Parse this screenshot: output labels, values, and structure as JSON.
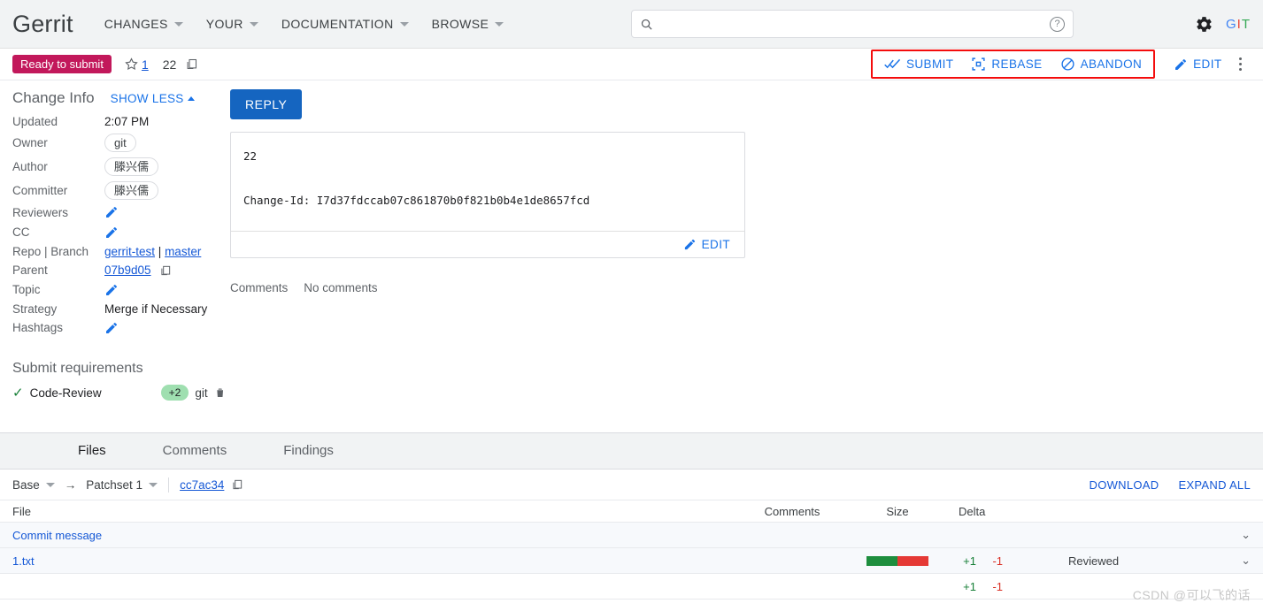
{
  "header": {
    "brand": "Gerrit",
    "nav": [
      {
        "label": "CHANGES",
        "icon": "chevron-down-icon"
      },
      {
        "label": "YOUR",
        "icon": "chevron-down-icon"
      },
      {
        "label": "DOCUMENTATION",
        "icon": "chevron-down-icon"
      },
      {
        "label": "BROWSE",
        "icon": "chevron-down-icon"
      }
    ],
    "search": {
      "value": "",
      "placeholder": "",
      "icon": "search-icon"
    },
    "help_icon": "help-circle-icon",
    "settings_icon": "gear-icon",
    "account": {
      "label": "GIT",
      "letters": [
        "G",
        "I",
        "T"
      ]
    }
  },
  "action_bar": {
    "status": "Ready to submit",
    "star_icon": "star-outline-icon",
    "star_count": "1",
    "change_number": "22",
    "copy_icon": "copy-icon",
    "highlighted_actions": [
      {
        "label": "SUBMIT",
        "icon": "double-check-icon"
      },
      {
        "label": "REBASE",
        "icon": "rebase-icon"
      },
      {
        "label": "ABANDON",
        "icon": "block-icon"
      }
    ],
    "edit": {
      "label": "EDIT",
      "icon": "pencil-icon"
    },
    "more_icon": "kebab-menu-icon",
    "highlight_color": "#f40c0c"
  },
  "change_info": {
    "title": "Change Info",
    "toggle_label": "SHOW LESS",
    "rows": [
      {
        "label": "Updated",
        "value": "2:07 PM",
        "type": "text"
      },
      {
        "label": "Owner",
        "value": "git",
        "type": "chip"
      },
      {
        "label": "Author",
        "value": "滕兴儒",
        "type": "chip"
      },
      {
        "label": "Committer",
        "value": "滕兴儒",
        "type": "chip"
      },
      {
        "label": "Reviewers",
        "value": "",
        "type": "edit"
      },
      {
        "label": "CC",
        "value": "",
        "type": "edit"
      },
      {
        "label": "Repo | Branch",
        "value": "",
        "type": "repo",
        "repo": "gerrit-test",
        "separator": "|",
        "branch": "master"
      },
      {
        "label": "Parent",
        "value": "07b9d05",
        "type": "link-copy"
      },
      {
        "label": "Topic",
        "value": "",
        "type": "edit"
      },
      {
        "label": "Strategy",
        "value": "Merge if Necessary",
        "type": "text"
      },
      {
        "label": "Hashtags",
        "value": "",
        "type": "edit"
      }
    ]
  },
  "submit_requirements": {
    "title": "Submit requirements",
    "rows": [
      {
        "check_icon": "check-icon",
        "name": "Code-Review",
        "vote": "+2",
        "voter": "git",
        "delete_icon": "trash-icon",
        "vote_color": "#9fdfb0"
      }
    ]
  },
  "commit": {
    "reply_label": "REPLY",
    "subject": "22",
    "change_id_line": "Change-Id: I7d37fdccab07c861870b0f821b0b4e1de8657fcd",
    "edit_label": "EDIT",
    "edit_icon": "pencil-icon",
    "comments_label": "Comments",
    "comments_value": "No comments"
  },
  "tabs": [
    {
      "label": "Files",
      "active": true
    },
    {
      "label": "Comments",
      "active": false
    },
    {
      "label": "Findings",
      "active": false
    }
  ],
  "patchset_row": {
    "base_label": "Base",
    "arrow": "→",
    "patchset_label": "Patchset 1",
    "revision": "cc7ac34",
    "copy_icon": "copy-icon",
    "download_label": "DOWNLOAD",
    "expand_all_label": "EXPAND ALL"
  },
  "file_table": {
    "columns": {
      "file": "File",
      "comments": "Comments",
      "size": "Size",
      "delta": "Delta"
    },
    "rows": [
      {
        "file": "Commit message",
        "comments": "",
        "size_bar": false,
        "added": "",
        "removed": "",
        "status": "",
        "chevron": "⌄"
      },
      {
        "file": "1.txt",
        "comments": "",
        "size_bar": true,
        "added": "+1",
        "removed": "-1",
        "status": "Reviewed",
        "chevron": "⌄"
      }
    ],
    "totals": {
      "added": "+1",
      "removed": "-1"
    },
    "added_color": "#1e8e3e",
    "removed_color": "#d93025"
  },
  "watermark": "CSDN @可以飞的话"
}
